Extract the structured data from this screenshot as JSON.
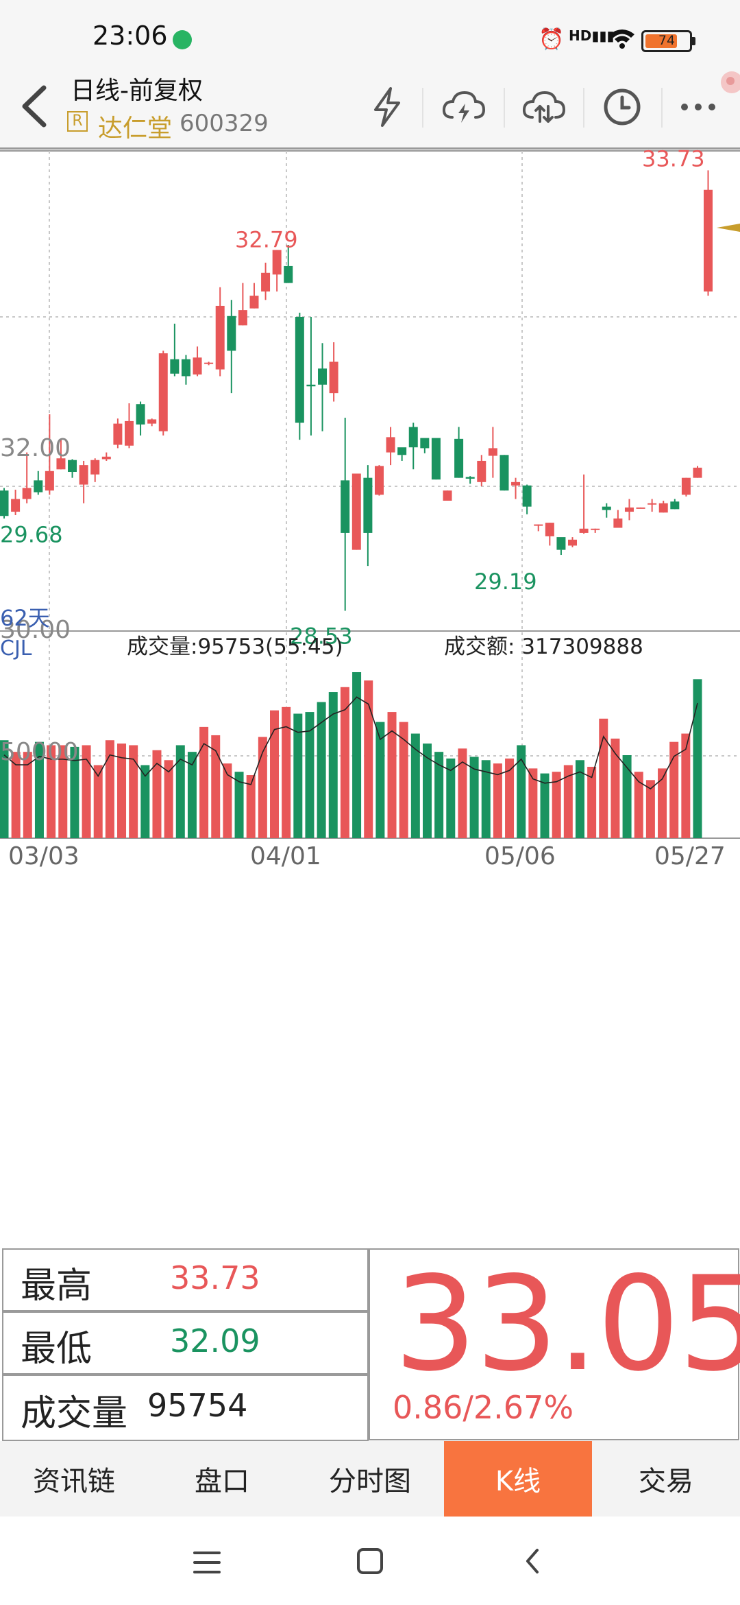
{
  "status_bar": {
    "time": "23:06",
    "battery": "74",
    "icons": [
      "alarm-icon",
      "hd-signal-icon",
      "wifi-icon",
      "battery-icon"
    ]
  },
  "header": {
    "title": "日线-前复权",
    "stock_tag": "R",
    "stock_name": "达仁堂",
    "stock_code": "600329",
    "icons": [
      "back-icon",
      "lightning-icon",
      "cloud-lightning-icon",
      "cloud-sync-icon",
      "clock-icon",
      "more-icon"
    ]
  },
  "chart": {
    "price_axis_labels": [
      "32.00",
      "30.00"
    ],
    "period_label": "62天",
    "high_marker": "33.73",
    "peak_marker": "32.79",
    "low_marker": "28.53",
    "start_low_marker": "29.68",
    "trough_marker": "29.19",
    "volume_indicator": "CJL",
    "volume_text": "成交量:95753(55:45)",
    "amount_text": "成交额: 317309888",
    "volume_axis_label": "50000",
    "date_labels": [
      "03/03",
      "04/01",
      "05/06",
      "05/27"
    ],
    "colors": {
      "up": "#e85758",
      "down": "#1a9360",
      "grid": "#c8c8c8",
      "volume_line": "#222222"
    }
  },
  "chart_data": {
    "type": "candlestick",
    "date_labels": [
      "03/03",
      "04/01",
      "05/06",
      "05/27"
    ],
    "price_labels": {
      "high": 33.73,
      "peak": 32.79,
      "low": 28.53,
      "start_low": 29.68,
      "trough": 29.19
    },
    "candles": [
      [
        29.95,
        29.65,
        29.98,
        29.62
      ],
      [
        29.7,
        29.85,
        29.96,
        29.66
      ],
      [
        29.85,
        29.98,
        30.4,
        29.8
      ],
      [
        30.07,
        29.93,
        30.18,
        29.9
      ],
      [
        29.95,
        30.18,
        30.85,
        29.9
      ],
      [
        30.2,
        30.33,
        30.55,
        30.2
      ],
      [
        30.31,
        30.17,
        30.32,
        30.1
      ],
      [
        30.02,
        30.25,
        30.3,
        29.8
      ],
      [
        30.14,
        30.31,
        30.33,
        30.05
      ],
      [
        30.32,
        30.35,
        30.4,
        30.3
      ],
      [
        30.49,
        30.74,
        30.8,
        30.45
      ],
      [
        30.48,
        30.77,
        30.98,
        30.45
      ],
      [
        30.97,
        30.73,
        31.0,
        30.6
      ],
      [
        30.74,
        30.79,
        30.8,
        30.71
      ],
      [
        30.65,
        31.57,
        31.6,
        30.6
      ],
      [
        31.5,
        31.33,
        31.92,
        31.3
      ],
      [
        31.5,
        31.3,
        31.55,
        31.2
      ],
      [
        31.32,
        31.52,
        31.65,
        31.3
      ],
      [
        31.45,
        31.46,
        31.47,
        31.43
      ],
      [
        31.38,
        32.13,
        32.35,
        31.3
      ],
      [
        32.01,
        31.6,
        32.2,
        31.1
      ],
      [
        31.9,
        32.08,
        32.4,
        31.9
      ],
      [
        32.1,
        32.25,
        32.4,
        32.1
      ],
      [
        32.3,
        32.52,
        32.64,
        32.2
      ],
      [
        32.5,
        32.79,
        32.79,
        32.3
      ],
      [
        32.6,
        32.4,
        32.85,
        32.4
      ],
      [
        32.0,
        30.75,
        32.05,
        30.55
      ],
      [
        31.2,
        31.18,
        32.0,
        30.6
      ],
      [
        31.39,
        31.2,
        31.69,
        30.65
      ],
      [
        31.1,
        31.47,
        31.7,
        31.0
      ],
      [
        30.07,
        29.45,
        30.81,
        28.53
      ],
      [
        29.25,
        30.15,
        30.15,
        29.25
      ],
      [
        30.1,
        29.45,
        30.25,
        29.06
      ],
      [
        29.9,
        30.24,
        30.25,
        29.89
      ],
      [
        30.4,
        30.58,
        30.7,
        30.25
      ],
      [
        30.46,
        30.37,
        30.37,
        30.3
      ],
      [
        30.7,
        30.46,
        30.75,
        30.2
      ],
      [
        30.57,
        30.45,
        30.55,
        30.39
      ],
      [
        30.57,
        30.08,
        30.5,
        30.08
      ],
      [
        29.83,
        29.95,
        29.95,
        29.83
      ],
      [
        30.56,
        30.1,
        30.7,
        30.1
      ],
      [
        30.11,
        30.09,
        30.12,
        30.03
      ],
      [
        30.05,
        30.3,
        30.37,
        30.0
      ],
      [
        30.36,
        30.45,
        30.7,
        30.1
      ],
      [
        30.37,
        29.95,
        30.37,
        29.95
      ],
      [
        30.01,
        30.05,
        30.1,
        29.85
      ],
      [
        30.01,
        29.76,
        30.02,
        29.67
      ],
      [
        29.54,
        29.55,
        29.55,
        29.47
      ],
      [
        29.41,
        29.57,
        29.57,
        29.3
      ],
      [
        29.4,
        29.25,
        29.25,
        29.19
      ],
      [
        29.3,
        29.37,
        29.4,
        29.28
      ],
      [
        29.45,
        29.5,
        30.14,
        29.44
      ],
      [
        29.5,
        29.5,
        29.5,
        29.45
      ],
      [
        29.76,
        29.72,
        29.8,
        29.63
      ],
      [
        29.51,
        29.62,
        29.72,
        29.51
      ],
      [
        29.7,
        29.75,
        29.85,
        29.6
      ],
      [
        29.75,
        29.75,
        29.75,
        29.74
      ],
      [
        29.8,
        29.8,
        29.85,
        29.7
      ],
      [
        29.69,
        29.8,
        29.83,
        29.69
      ],
      [
        29.82,
        29.73,
        29.85,
        29.73
      ],
      [
        29.9,
        30.1,
        30.1,
        29.88
      ],
      [
        30.1,
        30.22,
        30.24,
        30.1
      ]
    ],
    "volumes": [
      59000,
      52000,
      52000,
      58000,
      56000,
      56000,
      55000,
      56000,
      44000,
      59000,
      57000,
      56000,
      44000,
      53000,
      47000,
      56000,
      52000,
      67000,
      62000,
      45000,
      40000,
      38000,
      61000,
      77000,
      79000,
      75000,
      76000,
      82000,
      88000,
      91000,
      100000,
      95000,
      70000,
      76000,
      70000,
      63000,
      57000,
      52000,
      48000,
      54000,
      49000,
      47000,
      45000,
      48000,
      56000,
      42000,
      39000,
      40000,
      44000,
      47000,
      43000,
      72000,
      60000,
      50000,
      40000,
      35000,
      42000,
      58000,
      63000,
      95754
    ]
  },
  "quote": {
    "high_label": "最高",
    "high_value": "33.73",
    "low_label": "最低",
    "low_value": "32.09",
    "volume_label": "成交量",
    "volume_value": "95754",
    "price": "33.05",
    "change": "0.86/2.67%"
  },
  "tabs": [
    {
      "label": "资讯链"
    },
    {
      "label": "盘口"
    },
    {
      "label": "分时图"
    },
    {
      "label": "K线"
    },
    {
      "label": "交易"
    }
  ]
}
